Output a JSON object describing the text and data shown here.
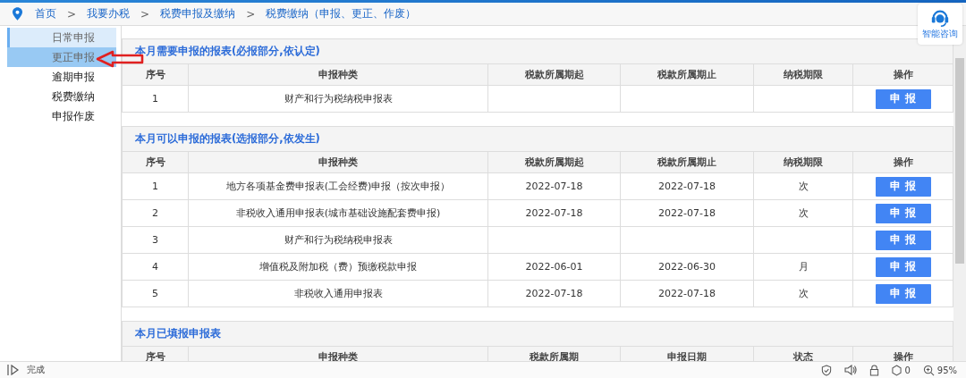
{
  "breadcrumb": [
    "首页",
    "我要办税",
    "税费申报及缴纳",
    "税费缴纳（申报、更正、作废）"
  ],
  "breadcrumb_separator": ">",
  "help_widget": {
    "label": "智能咨询"
  },
  "sidebar": {
    "items": [
      {
        "label": "日常申报",
        "selected": false,
        "open": true
      },
      {
        "label": "更正申报",
        "selected": true,
        "open": false
      },
      {
        "label": "逾期申报",
        "selected": false,
        "open": false
      },
      {
        "label": "税费缴纳",
        "selected": false,
        "open": false
      },
      {
        "label": "申报作废",
        "selected": false,
        "open": false
      }
    ]
  },
  "sections": [
    {
      "title": "本月需要申报的报表(必报部分,依认定)",
      "columns": [
        "序号",
        "申报种类",
        "税款所属期起",
        "税款所属期止",
        "纳税期限",
        "操作"
      ],
      "rows": [
        {
          "cells": [
            "1",
            "财产和行为税纳税申报表",
            "",
            "",
            ""
          ],
          "action": "申 报"
        }
      ]
    },
    {
      "title": "本月可以申报的报表(选报部分,依发生)",
      "columns": [
        "序号",
        "申报种类",
        "税款所属期起",
        "税款所属期止",
        "纳税期限",
        "操作"
      ],
      "rows": [
        {
          "cells": [
            "1",
            "地方各项基金费申报表(工会经费)申报（按次申报）",
            "2022-07-18",
            "2022-07-18",
            "次"
          ],
          "action": "申 报"
        },
        {
          "cells": [
            "2",
            "非税收入通用申报表(城市基础设施配套费申报)",
            "2022-07-18",
            "2022-07-18",
            "次"
          ],
          "action": "申 报"
        },
        {
          "cells": [
            "3",
            "财产和行为税纳税申报表",
            "",
            "",
            ""
          ],
          "action": "申 报"
        },
        {
          "cells": [
            "4",
            "增值税及附加税（费）预缴税款申报",
            "2022-06-01",
            "2022-06-30",
            "月"
          ],
          "action": "申 报"
        },
        {
          "cells": [
            "5",
            "非税收入通用申报表",
            "2022-07-18",
            "2022-07-18",
            "次"
          ],
          "action": "申 报"
        }
      ]
    },
    {
      "title": "本月已填报申报表",
      "columns": [
        "序号",
        "申报种类",
        "税款所属期",
        "申报日期",
        "状态",
        "操作"
      ]
    }
  ],
  "status_bar": {
    "status": "完成",
    "counter": "0",
    "zoom": "95%"
  }
}
